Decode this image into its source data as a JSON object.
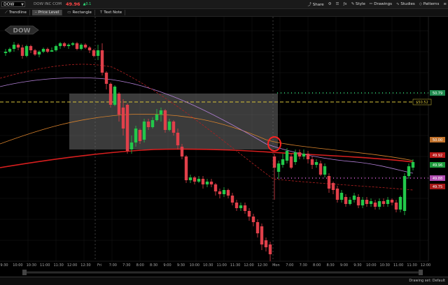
{
  "header": {
    "symbol": "DOW",
    "company": "DOW INC COM",
    "last_price": "49.96",
    "share_label": "Share",
    "style_label": "Style",
    "drawings_label": "Drawings",
    "studies_label": "Studies",
    "patterns_label": "Patterns",
    "price_change": "▲0.1"
  },
  "toolbar": {
    "tools": [
      "Trendline",
      "Price Level",
      "Rectangle",
      "Text Note"
    ]
  },
  "logo_text": "DOW",
  "price_tags": {
    "upper_green": "50.79",
    "level_yellow": "$50.52",
    "orange": "50.00",
    "red": "49.92",
    "last": "49.96",
    "magenta": "49.88",
    "lower_red": "49.75"
  },
  "time_axis": [
    "9:30",
    "10:00",
    "10:30",
    "11:00",
    "11:30",
    "12:00",
    "12:30",
    "Fri",
    "7:00",
    "7:30",
    "8:00",
    "8:30",
    "9:00",
    "9:30",
    "10:00",
    "10:30",
    "11:00",
    "11:30",
    "12:00",
    "12:30",
    "Mon",
    "7:00",
    "7:30",
    "8:00",
    "8:30",
    "9:00",
    "9:30",
    "10:00",
    "10:30",
    "11:00",
    "11:30",
    "12:00"
  ],
  "status": "Drawing set: Default",
  "colors": {
    "up": "#22c84a",
    "down": "#e0404a",
    "ema_red": "#d81e1e",
    "ema_orange": "#d9822b",
    "ema_violet": "#b27fd6",
    "level_yellow": "#d9c53a",
    "level_green": "#2fe07a",
    "level_magenta": "#e060e0"
  }
}
